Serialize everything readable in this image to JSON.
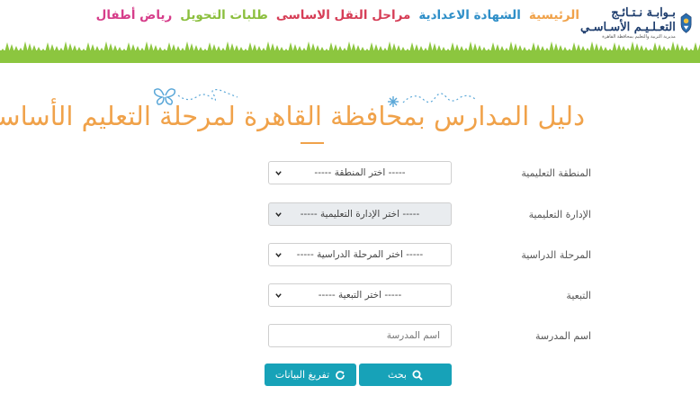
{
  "logo": {
    "line1": "بـوابـة نـتـائـج",
    "line2": "التعـلـيـم الأسـاسـي",
    "subtitle": "مديرية التربية والتعليم بمحافظة القاهرة"
  },
  "nav": {
    "items": [
      {
        "label": "الرئيسية",
        "color": "#f0a24a"
      },
      {
        "label": "الشهادة الاعدادية",
        "color": "#2f8fc8"
      },
      {
        "label": "مراحل النقل الاساسى",
        "color": "#d63d56"
      },
      {
        "label": "طلبات التحويل",
        "color": "#8bbf3d"
      },
      {
        "label": "رياض أطفال",
        "color": "#d63d8a"
      }
    ]
  },
  "page": {
    "title": "دليل المدارس بمحافظة القاهرة لمرحلة التعليم الأساسي"
  },
  "form": {
    "region": {
      "label": "المنطقة التعليمية",
      "selected": "----- اختر المنطقة -----"
    },
    "administration": {
      "label": "الإدارة التعليمية",
      "selected": "----- اختر الإدارة التعليمية -----"
    },
    "stage": {
      "label": "المرحلة الدراسية",
      "selected": "----- اختر المرحلة الدراسية -----"
    },
    "affiliation": {
      "label": "التبعية",
      "selected": "----- اختر التبعية -----"
    },
    "school_name": {
      "label": "اسم المدرسة",
      "placeholder": "اسم المدرسة",
      "value": ""
    },
    "search_label": "بحث",
    "clear_label": "تفريغ البيانات"
  },
  "colors": {
    "accent": "#f0a24a",
    "button": "#17a2b8",
    "grass": "#8cc63f"
  }
}
